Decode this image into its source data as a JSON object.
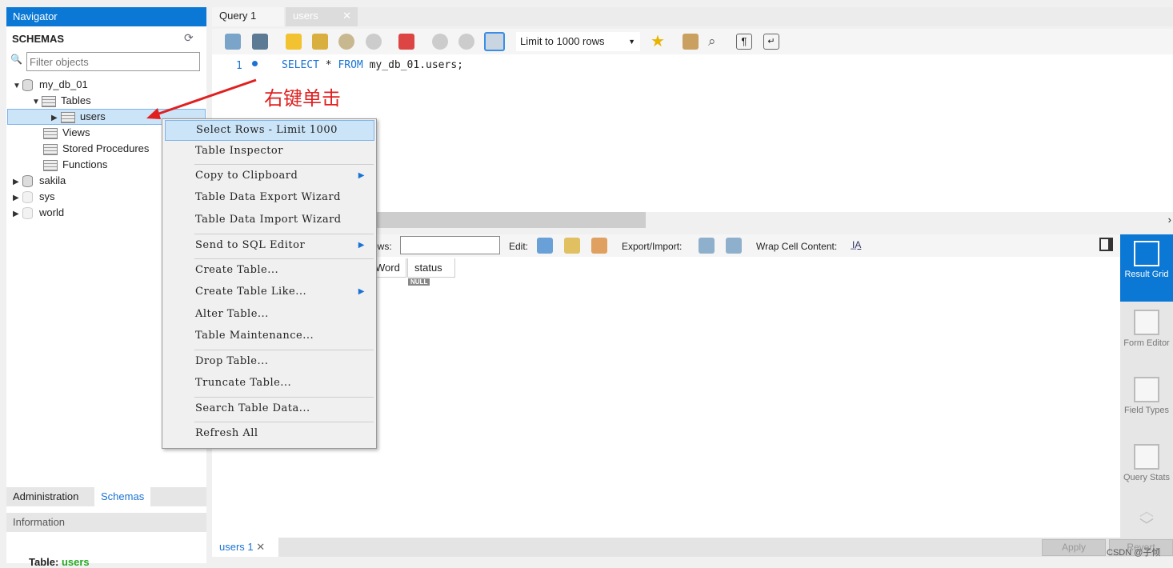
{
  "navigator": {
    "title": "Navigator",
    "schemas_label": "SCHEMAS",
    "filter_placeholder": "Filter objects",
    "tree": {
      "db1": "my_db_01",
      "tables": "Tables",
      "users": "users",
      "views": "Views",
      "procs": "Stored Procedures",
      "funcs": "Functions",
      "db2": "sakila",
      "db3": "sys",
      "db4": "world"
    },
    "bottom_tabs": [
      "Administration",
      "Schemas"
    ],
    "info_title": "Information",
    "info_table_label": "Table:",
    "info_table_value": "users"
  },
  "tabs": [
    {
      "label": "Query 1",
      "active": true
    },
    {
      "label": "users",
      "active": false
    }
  ],
  "toolbar": {
    "limit_select": "Limit to 1000 rows"
  },
  "editor": {
    "line_number": "1",
    "kw1": "SELECT",
    "star": " * ",
    "kw2": "FROM",
    "rest": " my_db_01.users;"
  },
  "annotation": {
    "text": "右键单击",
    "color": "#e02020"
  },
  "context_menu": {
    "items": [
      "Select Rows - Limit 1000",
      "Table Inspector",
      "Copy to Clipboard",
      "Table Data Export Wizard",
      "Table Data Import Wizard",
      "Send to SQL Editor",
      "Create Table...",
      "Create Table Like...",
      "Alter Table...",
      "Table Maintenance...",
      "Drop Table...",
      "Truncate Table...",
      "Search Table Data...",
      "Refresh All"
    ]
  },
  "result_toolbar": {
    "filter_label": "ows:",
    "edit_label": "Edit:",
    "export_label": "Export/Import:",
    "wrap_label": "Wrap Cell Content:"
  },
  "result_grid": {
    "columns": [
      "Word",
      "status"
    ],
    "null_badge": "NULL"
  },
  "side_panel": [
    "Result Grid",
    "Form Editor",
    "Field Types",
    "Query Stats"
  ],
  "bottom": {
    "tab": "users 1",
    "apply": "Apply",
    "revert": "Revert"
  },
  "watermark": "CSDN @子倾",
  "colors": {
    "accent": "#0a78d4",
    "keyword": "#1a73d4"
  }
}
